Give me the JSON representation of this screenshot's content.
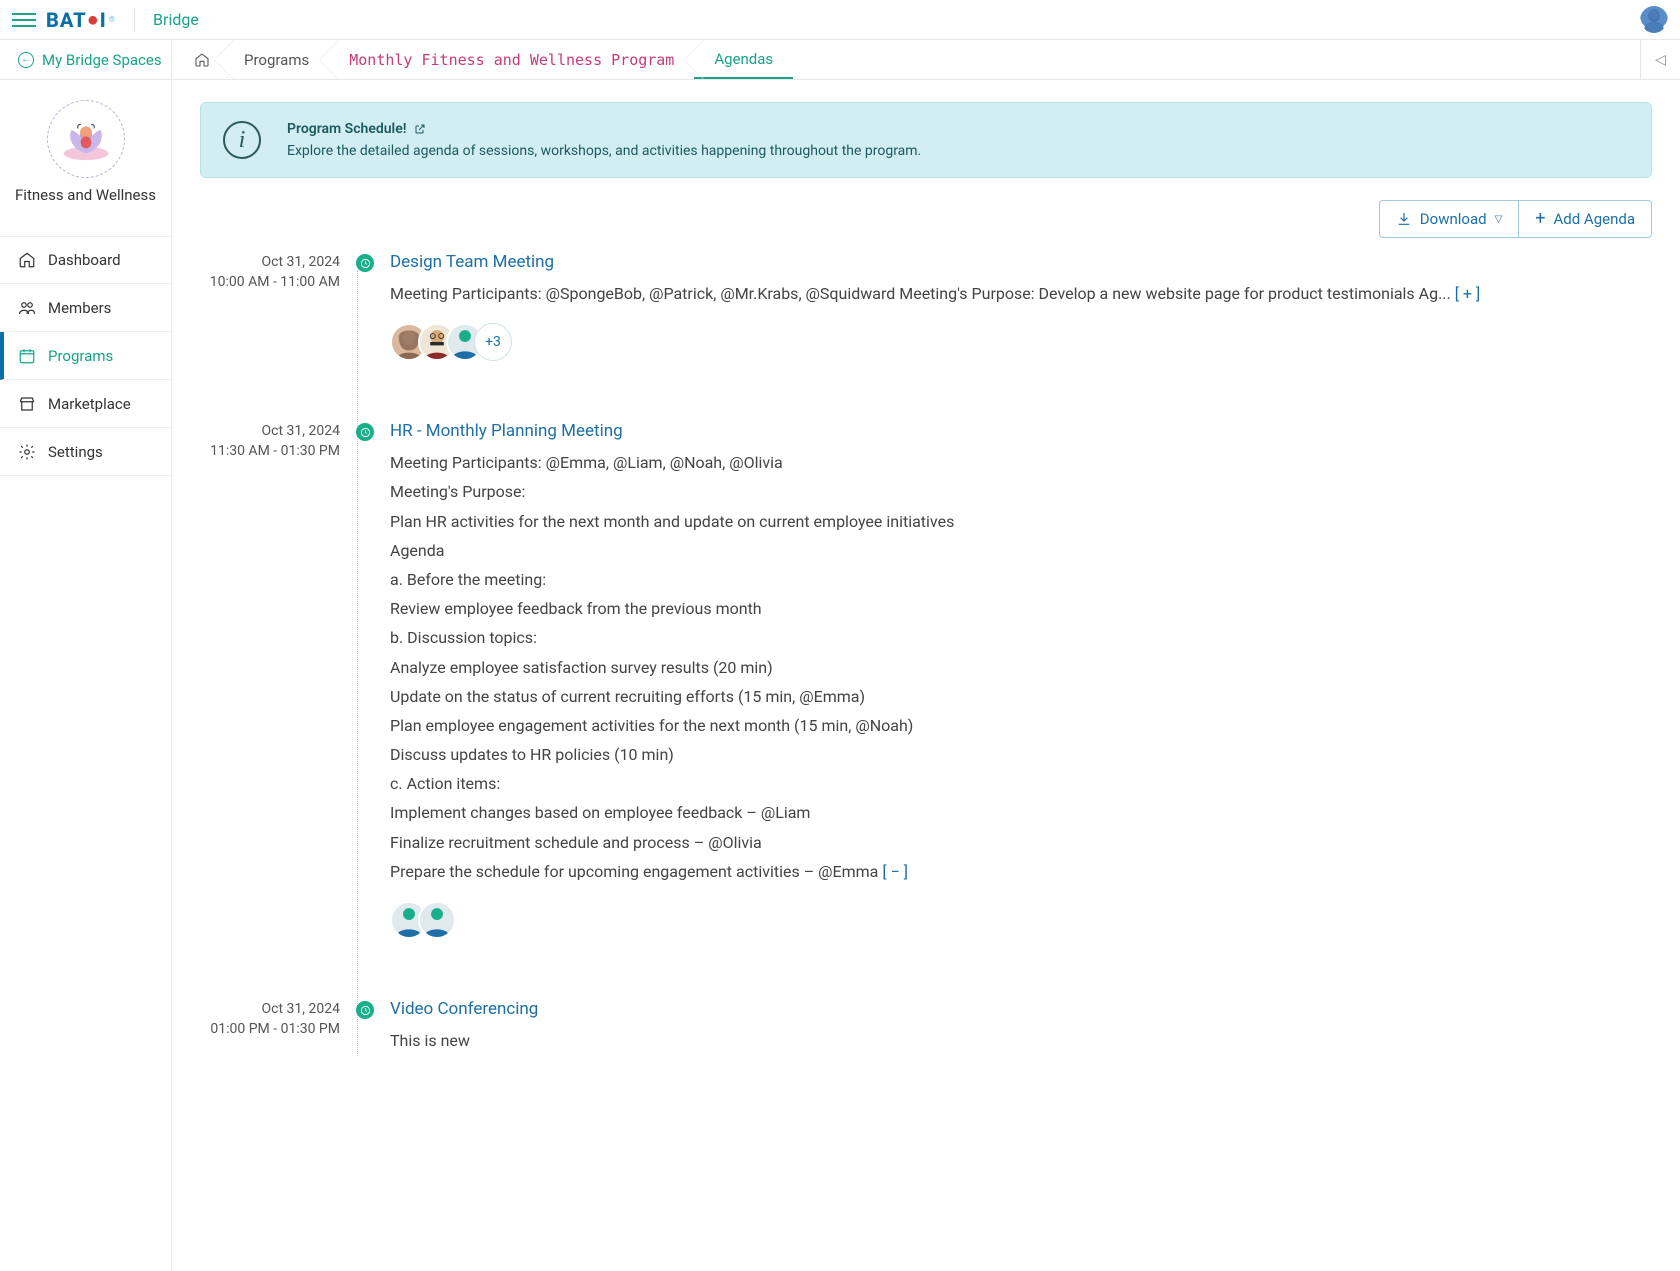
{
  "topbar": {
    "app": "Bridge",
    "logo_text_1": "BAT",
    "logo_text_2": "I"
  },
  "secondbar": {
    "my_spaces": "My Bridge Spaces"
  },
  "breadcrumbs": {
    "programs": "Programs",
    "program_name": "Monthly Fitness and Wellness Program",
    "agendas": "Agendas"
  },
  "sidebar": {
    "space_name": "Fitness and Wellness",
    "items": [
      {
        "label": "Dashboard"
      },
      {
        "label": "Members"
      },
      {
        "label": "Programs"
      },
      {
        "label": "Marketplace"
      },
      {
        "label": "Settings"
      }
    ]
  },
  "banner": {
    "title": "Program Schedule!",
    "desc": "Explore the detailed agenda of sessions, workshops, and activities happening throughout the program."
  },
  "actions": {
    "download": "Download",
    "add_agenda": "Add Agenda"
  },
  "expand_label": "[ + ]",
  "collapse_label": "[ − ]",
  "agendas": [
    {
      "date": "Oct 31, 2024",
      "time": "10:00 AM - 11:00 AM",
      "title": "Design Team Meeting",
      "summary": "Meeting Participants: @SpongeBob, @Patrick, @Mr.Krabs, @Squidward Meeting's Purpose: Develop a new website page for product testimonials Ag...",
      "more_count": "+3"
    },
    {
      "date": "Oct 31, 2024",
      "time": "11:30 AM - 01:30 PM",
      "title": "HR - Monthly Planning Meeting",
      "lines": [
        "Meeting Participants: @Emma, @Liam, @Noah, @Olivia",
        "Meeting's Purpose:",
        "Plan HR activities for the next month and update on current employee initiatives",
        "Agenda",
        "a. Before the meeting:",
        "Review employee feedback from the previous month",
        "b. Discussion topics:",
        "Analyze employee satisfaction survey results (20 min)",
        "Update on the status of current recruiting efforts (15 min, @Emma)",
        "Plan employee engagement activities for the next month (15 min, @Noah)",
        "Discuss updates to HR policies (10 min)",
        "c. Action items:",
        "Implement changes based on employee feedback – @Liam",
        "Finalize recruitment schedule and process – @Olivia",
        "Prepare the schedule for upcoming engagement activities – @Emma"
      ]
    },
    {
      "date": "Oct 31, 2024",
      "time": "01:00 PM - 01:30 PM",
      "title": "Video Conferencing",
      "summary": "This is new"
    }
  ]
}
